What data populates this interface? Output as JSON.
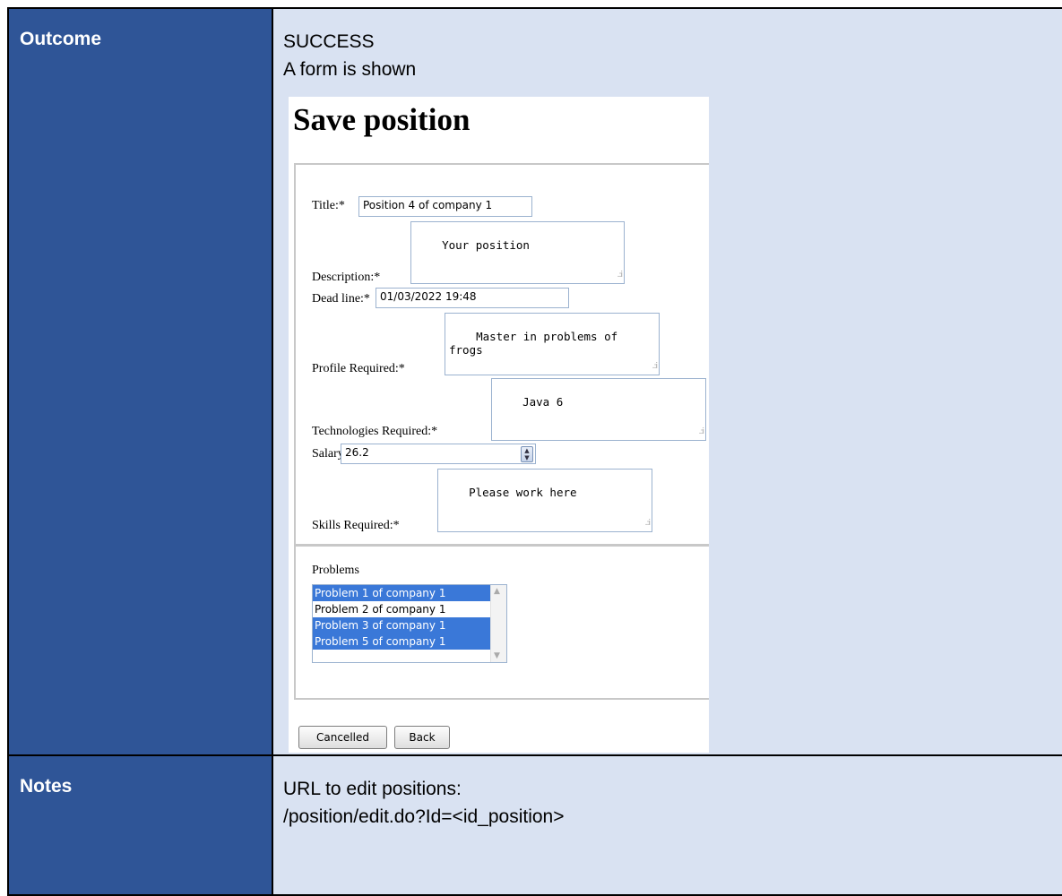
{
  "table": {
    "row1": {
      "label": "Outcome",
      "line1": "SUCCESS",
      "line2": "A form is shown"
    },
    "row2": {
      "label": "Notes",
      "line1": "URL to edit positions:",
      "line2": "/position/edit.do?Id=<id_position>"
    }
  },
  "colors": {
    "label_bg": "#2f5597",
    "content_bg": "#d9e2f2",
    "selected_option": "#3a78d8"
  },
  "form": {
    "heading": "Save position",
    "title_label": "Title:*",
    "title_value": "Position 4 of company 1",
    "description_label": "Description:*",
    "description_value": "Your position",
    "deadline_label": "Dead line:*",
    "deadline_value": "01/03/2022 19:48",
    "profile_label": "Profile Required:*",
    "profile_value": "Master in problems of frogs",
    "technologies_label": "Technologies Required:*",
    "technologies_value": "Java 6",
    "salary_label": "Salary:",
    "salary_value": "26.2",
    "skills_label": "Skills Required:*",
    "skills_value": "Please work here",
    "problems_label": "Problems",
    "problems": [
      {
        "label": "Problem 1 of company 1",
        "selected": true
      },
      {
        "label": "Problem 2 of company 1",
        "selected": false
      },
      {
        "label": "Problem 3 of company 1",
        "selected": true
      },
      {
        "label": "Problem 5 of company 1",
        "selected": true
      }
    ],
    "cancel_label": "Cancelled",
    "back_label": "Back"
  }
}
